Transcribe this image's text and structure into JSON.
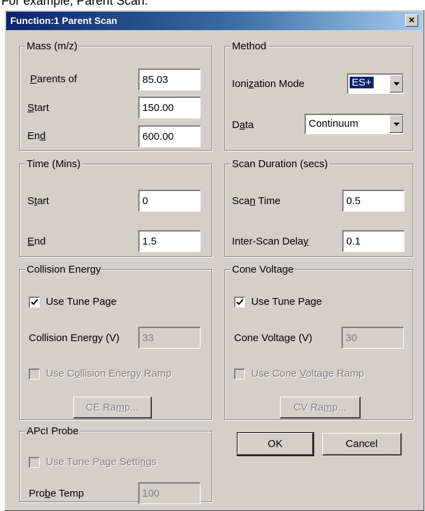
{
  "caption": "For example, Parent Scan:",
  "dialog": {
    "title": "Function:1 Parent Scan",
    "close_glyph": "×"
  },
  "mass": {
    "legend": "Mass (m/z)",
    "parents_of": {
      "label_u": "P",
      "label_rest": "arents of",
      "value": "85.03"
    },
    "start": {
      "label_u": "S",
      "label_rest": "tart",
      "value": "150.00"
    },
    "end": {
      "label_pre": "En",
      "label_u": "d",
      "label_rest": "",
      "value": "600.00"
    }
  },
  "method": {
    "legend": "Method",
    "ionization": {
      "label_pre": "Ioni",
      "label_u": "z",
      "label_rest": "ation Mode",
      "value": "ES+"
    },
    "data": {
      "label_pre": "D",
      "label_u": "a",
      "label_rest": "ta",
      "value": "Continuum"
    }
  },
  "time": {
    "legend": "Time (Mins)",
    "start": {
      "label_pre": "S",
      "label_u": "t",
      "label_rest": "art",
      "value": "0"
    },
    "end": {
      "label_u": "E",
      "label_rest": "nd",
      "value": "1.5"
    }
  },
  "scan_duration": {
    "legend": "Scan Duration (secs)",
    "scan_time": {
      "label_pre": "Sca",
      "label_u": "n",
      "label_rest": " Time",
      "value": "0.5"
    },
    "inter_scan": {
      "label_pre": "Inter-Scan Dela",
      "label_u": "y",
      "label_rest": "",
      "value": "0.1"
    }
  },
  "collision": {
    "legend": "Collision Energy",
    "use_tune_page": "Use Tune Page",
    "energy_label": "Collision Energy (V)",
    "energy_value": "33",
    "ramp": {
      "label_pre": "Use C",
      "label_u": "o",
      "label_rest": "llision Energy Ramp"
    },
    "ramp_button": {
      "label_pre": "CE Ra",
      "label_u": "m",
      "label_rest": "p..."
    }
  },
  "cone": {
    "legend": "Cone Voltage",
    "use_tune_page": "Use Tune Page",
    "voltage_label": "Cone Voltage (V)",
    "voltage_value": "30",
    "ramp": {
      "label_pre": "Use Cone ",
      "label_u": "V",
      "label_rest": "oltage Ramp"
    },
    "ramp_button": {
      "label_pre": "CV Ra",
      "label_u": "m",
      "label_rest": "p..."
    }
  },
  "apci": {
    "legend": "APcI Probe",
    "use_settings": {
      "label_pre": "Use Tune Page Setti",
      "label_u": "n",
      "label_rest": "gs"
    },
    "probe_temp": {
      "label_pre": "Pro",
      "label_u": "b",
      "label_rest": "e Temp",
      "value": "100"
    }
  },
  "buttons": {
    "ok": "OK",
    "cancel": "Cancel"
  }
}
